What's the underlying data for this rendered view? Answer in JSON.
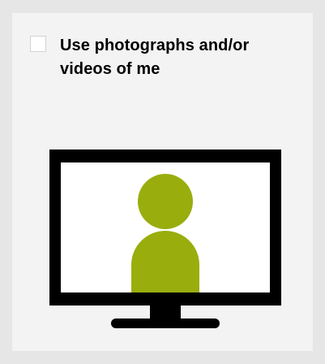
{
  "consent_option": {
    "label": "Use photographs and/or videos of me",
    "checked": false
  },
  "illustration": {
    "icon": "monitor-person-icon",
    "monitor_color": "#000000",
    "screen_color": "#ffffff",
    "person_color": "#99ad0d"
  },
  "colors": {
    "page_background": "#e6e6e6",
    "card_background": "#f3f3f3",
    "checkbox_border": "#d3d3d3"
  }
}
